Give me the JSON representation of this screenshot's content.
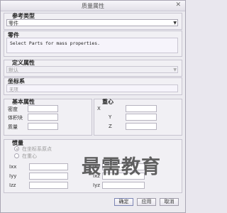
{
  "window": {
    "title": "质量属性",
    "close_glyph": "✕"
  },
  "reference_type": {
    "label": "参考类型",
    "value": "零件"
  },
  "part": {
    "label": "零件",
    "message": "Select Parts for mass properties."
  },
  "definition": {
    "label": "定义属性",
    "value": "默认"
  },
  "coordinate_system": {
    "label": "坐标系",
    "value": "无项"
  },
  "basic": {
    "label": "基本属性",
    "density": "密度",
    "volume": "体积块",
    "mass": "质量"
  },
  "centroid": {
    "label": "重心",
    "x": "X",
    "y": "Y",
    "z": "Z"
  },
  "inertia": {
    "label": "惯量",
    "options": [
      "在坐标系原点",
      "在重心"
    ],
    "selected_index": 0,
    "ixx": "Ixx",
    "iyy": "Iyy",
    "izz": "Izz",
    "ixy": "Ixy",
    "ixz": "Ixz",
    "iyz": "Iyz"
  },
  "buttons": {
    "ok": "确定",
    "apply": "应用",
    "cancel": "取消"
  },
  "watermark": "最需教育"
}
